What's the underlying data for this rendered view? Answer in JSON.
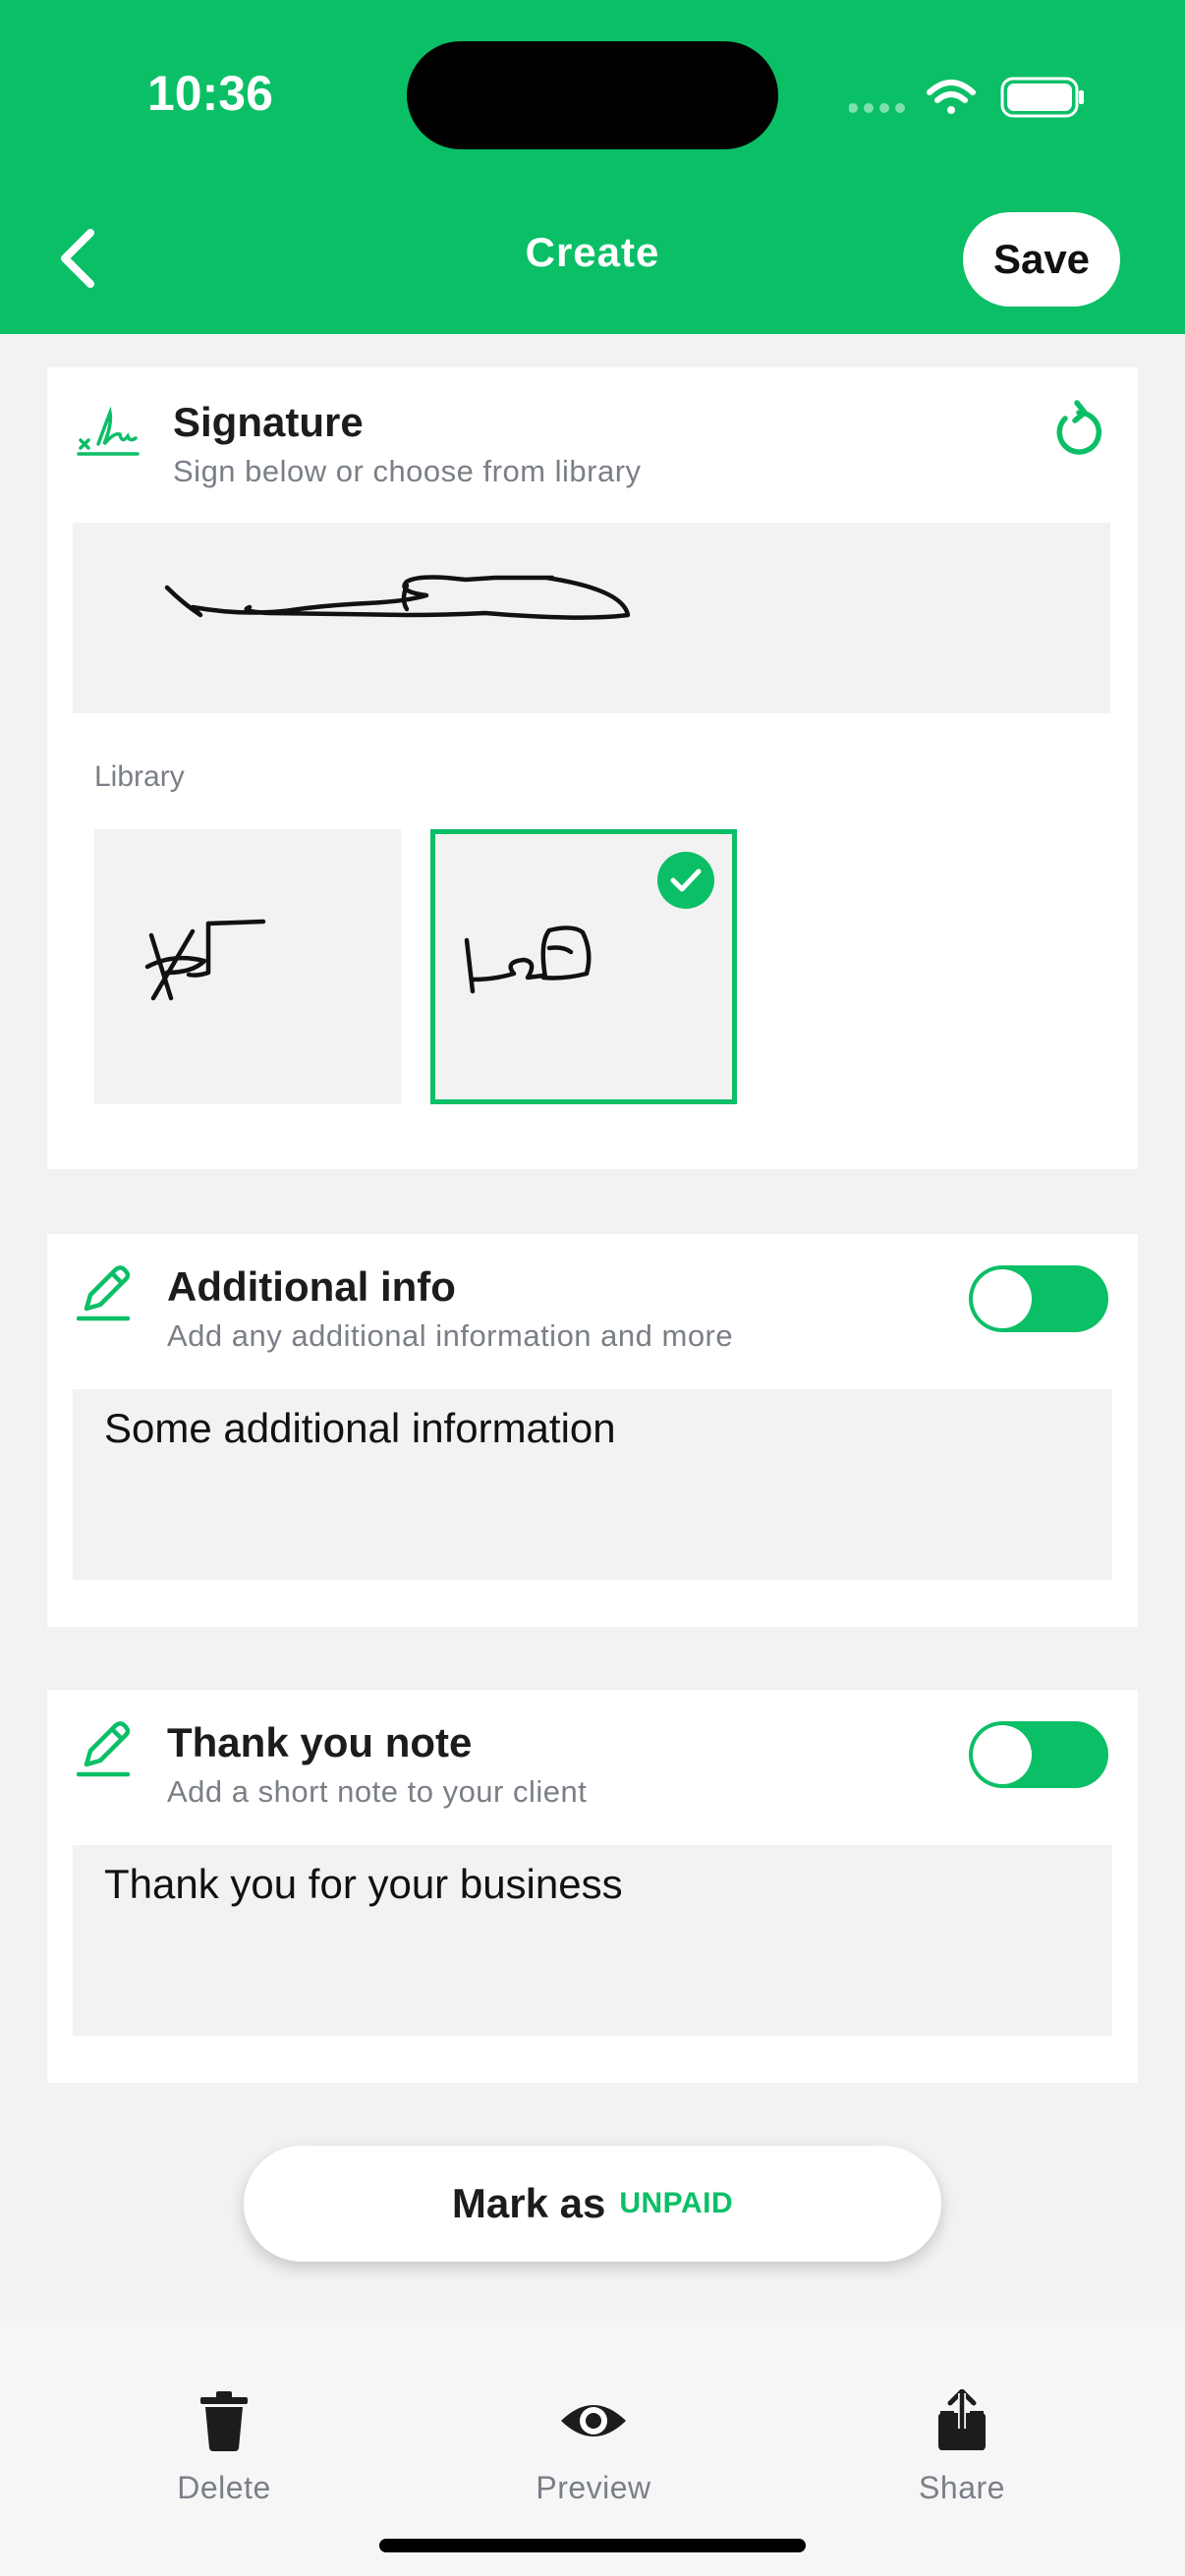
{
  "status_bar": {
    "time": "10:36"
  },
  "header": {
    "title": "Create",
    "save_label": "Save"
  },
  "signature": {
    "title": "Signature",
    "subtitle": "Sign below or choose from library",
    "library_label": "Library",
    "library_selected_index": 1
  },
  "additional_info": {
    "title": "Additional info",
    "subtitle": "Add any additional information and more",
    "enabled": true,
    "value": "Some additional information"
  },
  "thank_you": {
    "title": "Thank you note",
    "subtitle": "Add a short note to your client",
    "enabled": true,
    "value": "Thank you for your business"
  },
  "mark_as": {
    "prefix": "Mark as",
    "status": "UNPAID"
  },
  "toolbar": {
    "delete_label": "Delete",
    "preview_label": "Preview",
    "share_label": "Share"
  },
  "colors": {
    "accent": "#0bbf66",
    "text": "#1c1c1e",
    "muted": "#7a7f87"
  },
  "icons": [
    "signature-icon",
    "reset-icon",
    "pencil-icon",
    "trash-icon",
    "eye-icon",
    "share-icon",
    "chevron-left-icon",
    "checkmark-icon",
    "wifi-icon",
    "battery-icon"
  ]
}
